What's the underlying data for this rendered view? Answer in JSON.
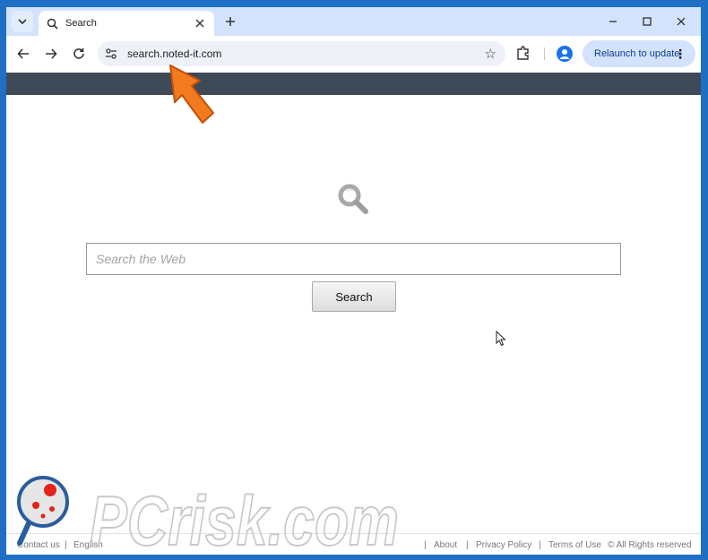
{
  "browser": {
    "tab": {
      "title": "Search"
    },
    "address": {
      "url": "search.noted-it.com"
    },
    "relaunch_label": "Relaunch to update"
  },
  "page": {
    "search": {
      "placeholder": "Search the Web",
      "button_label": "Search"
    },
    "footer": {
      "contact": "Contact us",
      "sep1": "|",
      "language": "English",
      "sep2": "|",
      "about": "About",
      "sep3": "|",
      "privacy": "Privacy Policy",
      "sep4": "|",
      "terms": "Terms of Use",
      "copyright": "© All Rights reserved"
    }
  },
  "watermark": {
    "text": "PCrisk.com"
  },
  "colors": {
    "accent": "#1a73e8",
    "tabstrip": "#d3e3fd",
    "header_bar": "#3e4a57",
    "arrow": "#f47a20"
  },
  "icons": [
    "tab-search-icon",
    "globe-icon",
    "close-icon",
    "plus-icon",
    "minimize-icon",
    "maximize-icon",
    "window-close-icon",
    "back-icon",
    "forward-icon",
    "reload-icon",
    "site-info-icon",
    "star-icon",
    "extensions-icon",
    "profile-icon",
    "more-icon",
    "magnifier-icon",
    "cursor-icon",
    "arrow-annotation"
  ]
}
